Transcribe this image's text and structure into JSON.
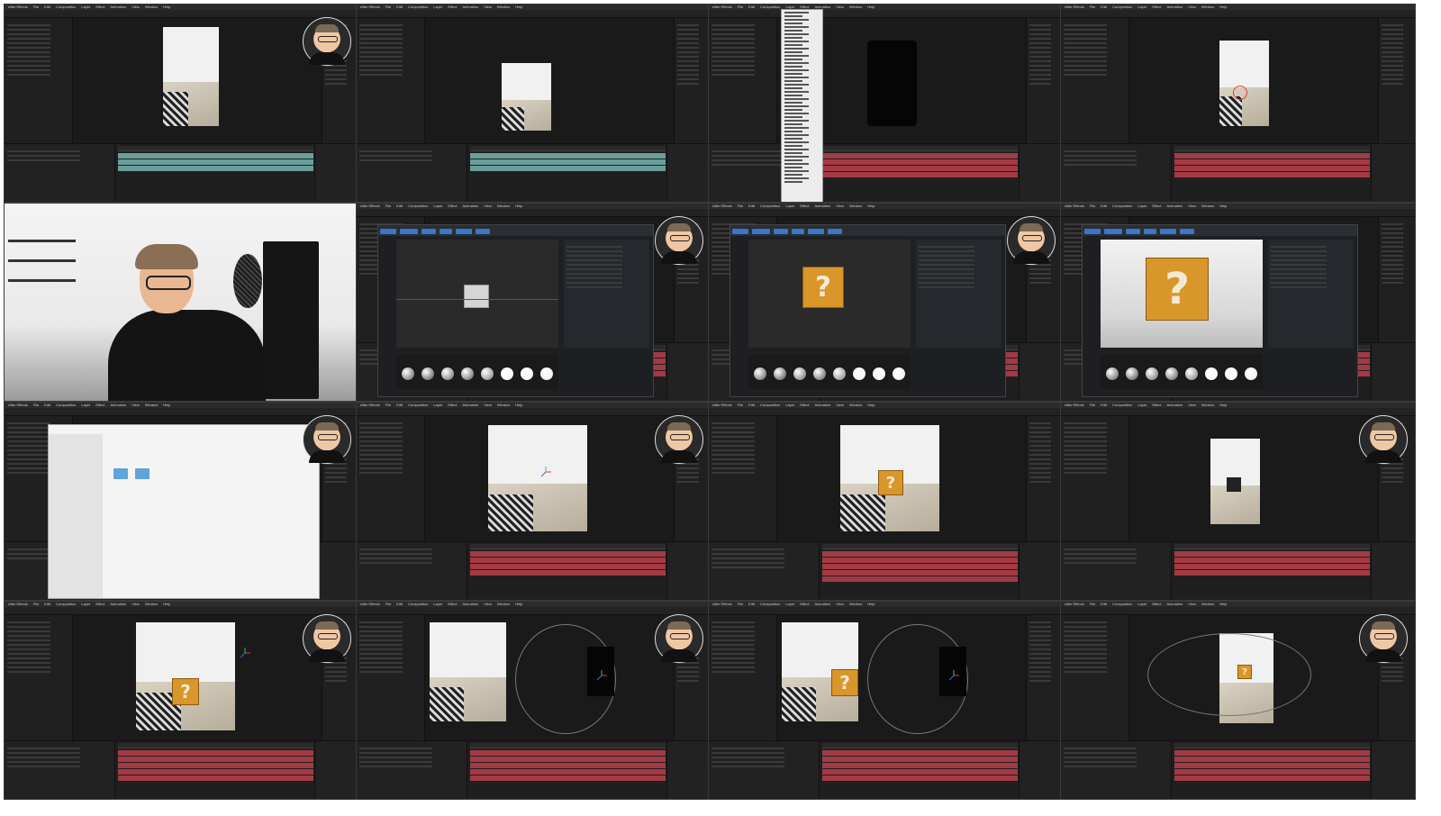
{
  "app": {
    "name": "After Effects",
    "menu": [
      "After Effects",
      "File",
      "Edit",
      "Composition",
      "Layer",
      "Effect",
      "Animation",
      "View",
      "Window",
      "Help"
    ]
  },
  "grid": {
    "rows": 4,
    "cols": 4
  },
  "tiles": [
    {
      "id": 1,
      "scene": "ae-vertical-footage",
      "webcam": true
    },
    {
      "id": 2,
      "scene": "ae-footage-small",
      "webcam": false
    },
    {
      "id": 3,
      "scene": "ae-effect-menu-open",
      "webcam": false
    },
    {
      "id": 4,
      "scene": "ae-footage-tracked",
      "webcam": false
    },
    {
      "id": 5,
      "scene": "presenter-camera",
      "webcam": false
    },
    {
      "id": 6,
      "scene": "element3d-cube",
      "webcam": true
    },
    {
      "id": 7,
      "scene": "element3d-question-box",
      "webcam": true
    },
    {
      "id": 8,
      "scene": "element3d-question-box-large",
      "webcam": false
    },
    {
      "id": 9,
      "scene": "finder-import-dialog",
      "webcam": true
    },
    {
      "id": 10,
      "scene": "ae-footage-box",
      "webcam": true
    },
    {
      "id": 11,
      "scene": "ae-footage-box-shadow",
      "webcam": false
    },
    {
      "id": 12,
      "scene": "ae-footage-shadow-plane",
      "webcam": true
    },
    {
      "id": 13,
      "scene": "ae-footage-box-gizmo",
      "webcam": true
    },
    {
      "id": 14,
      "scene": "ae-camera-view",
      "webcam": true
    },
    {
      "id": 15,
      "scene": "ae-camera-view-box",
      "webcam": false
    },
    {
      "id": 16,
      "scene": "ae-footage-vertical-camera",
      "webcam": true
    }
  ],
  "colors": {
    "ui_bg": "#1c1c1c",
    "panel": "#202020",
    "timeline_layer_red": "#a33a44",
    "timeline_layer_teal": "#6a9e9a",
    "accent_blue": "#3a76c9",
    "box_orange": "#d9962a"
  },
  "icons": [
    "webcam-bubble-icon",
    "folder-icon",
    "material-sphere-icon",
    "axis-gizmo-icon"
  ]
}
